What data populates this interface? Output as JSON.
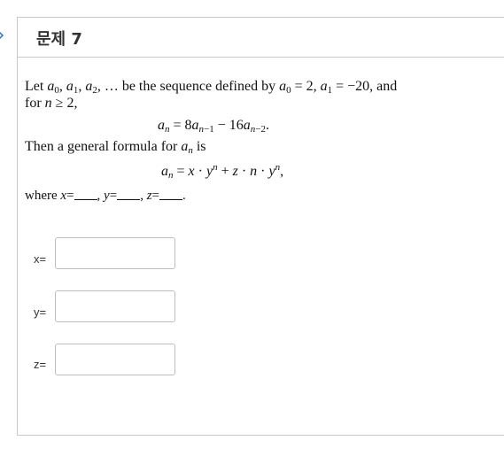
{
  "header": {
    "title": "문제 7"
  },
  "problem": {
    "intro_prefix": "Let ",
    "intro_seq": "a",
    "intro_mid": " be the sequence defined by ",
    "intro_end": ", and",
    "line2": "for ",
    "recurrence_lhs": "a",
    "then_text": "Then a general formula for ",
    "then_is": " is",
    "where_text": "where "
  },
  "fields": [
    {
      "label": "x=",
      "value": ""
    },
    {
      "label": "y=",
      "value": ""
    },
    {
      "label": "z=",
      "value": ""
    }
  ]
}
